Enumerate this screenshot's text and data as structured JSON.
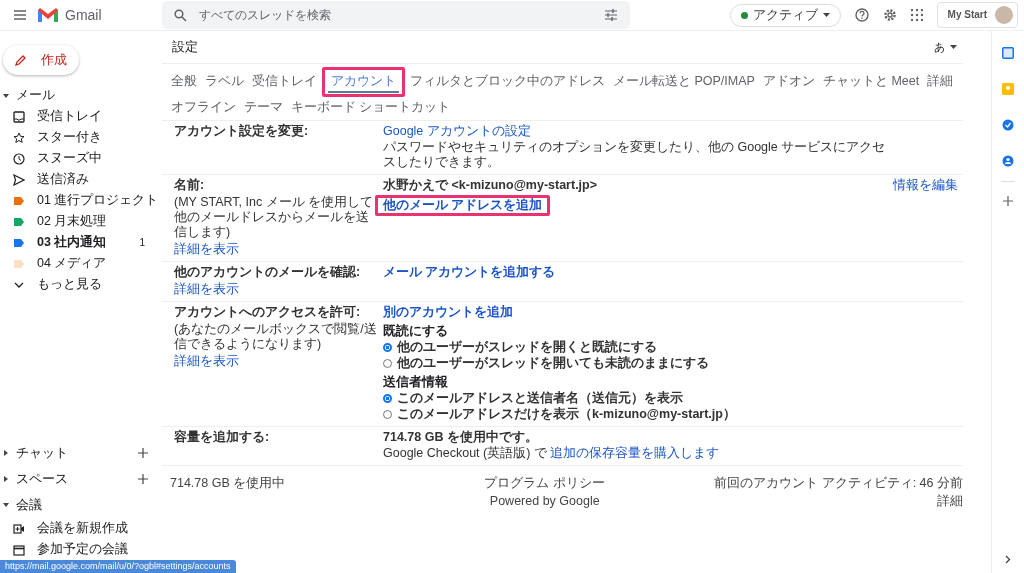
{
  "topbar": {
    "app_name": "Gmail",
    "search_placeholder": "すべてのスレッドを検索",
    "status": {
      "label": "アクティブ",
      "color": "#1e8e3e"
    },
    "org": "My Start"
  },
  "compose": "作成",
  "mail_section": {
    "label": "メール",
    "expanded": true
  },
  "sidebar_items": [
    {
      "label": "受信トレイ",
      "kind": "system",
      "unread": false
    },
    {
      "label": "スター付き",
      "kind": "system",
      "unread": false
    },
    {
      "label": "スヌーズ中",
      "kind": "system",
      "unread": false
    },
    {
      "label": "送信済み",
      "kind": "system",
      "unread": false
    },
    {
      "label": "01 進行プロジェクト",
      "kind": "label",
      "color": "#e8710a",
      "unread": false
    },
    {
      "label": "02 月末処理",
      "kind": "label",
      "color": "#16a766",
      "unread": false
    },
    {
      "label": "03 社内通知",
      "kind": "label",
      "color": "#1a73e8",
      "count": "1",
      "unread": true
    },
    {
      "label": "04 メディア",
      "kind": "label",
      "color": "#fbe0c3",
      "unread": false
    },
    {
      "label": "もっと見る",
      "kind": "more",
      "unread": false
    }
  ],
  "sections": [
    {
      "label": "チャット",
      "expanded": false
    },
    {
      "label": "スペース",
      "expanded": false
    },
    {
      "label": "会議",
      "expanded": true
    }
  ],
  "meet_items": [
    {
      "label": "会議を新規作成"
    },
    {
      "label": "参加予定の会議"
    }
  ],
  "settings": {
    "title": "設定",
    "input_tool": "あ",
    "tabs": [
      {
        "label": "全般",
        "selected": false,
        "highlighted": false
      },
      {
        "label": "ラベル",
        "selected": false,
        "highlighted": false
      },
      {
        "label": "受信トレイ",
        "selected": false,
        "highlighted": false
      },
      {
        "label": "アカウント",
        "selected": true,
        "highlighted": true
      },
      {
        "label": "フィルタとブロック中のアドレス",
        "selected": false,
        "highlighted": false
      },
      {
        "label": "メール転送と POP/IMAP",
        "selected": false,
        "highlighted": false
      },
      {
        "label": "アドオン",
        "selected": false,
        "highlighted": false
      },
      {
        "label": "チャットと Meet",
        "selected": false,
        "highlighted": false
      },
      {
        "label": "詳細",
        "selected": false,
        "highlighted": false
      },
      {
        "label": "オフライン",
        "selected": false,
        "highlighted": false
      },
      {
        "label": "テーマ",
        "selected": false,
        "highlighted": false
      },
      {
        "label": "キーボード ショートカット",
        "selected": false,
        "highlighted": false
      }
    ],
    "rows": [
      {
        "label": "アカウント設定を変更:",
        "content": [
          {
            "kind": "link",
            "text": "Google アカウントの設定",
            "bold": false,
            "highlighted": false
          },
          {
            "kind": "text",
            "text": "パスワードやセキュリティのオプションを変更したり、他の Google サービスにアクセスしたりできます。",
            "bold": false
          }
        ]
      },
      {
        "label": "名前:",
        "description": "(MY START, Inc メール を使用して他のメールドレスからメールを送信します)",
        "details_link": "詳細を表示",
        "edit_link": "情報を編集",
        "content": [
          {
            "kind": "text",
            "text": "水野かえで <k-mizuno@my-start.jp>",
            "bold": true
          },
          {
            "kind": "link",
            "text": "他のメール アドレスを追加",
            "bold": true,
            "highlighted": true
          }
        ]
      },
      {
        "label": "他のアカウントのメールを確認:",
        "details_link": "詳細を表示",
        "content": [
          {
            "kind": "link",
            "text": "メール アカウントを追加する",
            "bold": true,
            "highlighted": false
          }
        ]
      },
      {
        "label": "アカウントへのアクセスを許可:",
        "description": "(あなたのメールボックスで閲覧/送信できるようになります)",
        "details_link": "詳細を表示",
        "content": [
          {
            "kind": "link",
            "text": "別のアカウントを追加",
            "bold": true,
            "highlighted": false
          },
          {
            "kind": "radios",
            "title": "既読にする",
            "options": [
              {
                "label": "他のユーザーがスレッドを開くと既読にする",
                "selected": true
              },
              {
                "label": "他のユーザーがスレッドを開いても未読のままにする",
                "selected": false
              }
            ]
          },
          {
            "kind": "radios",
            "title": "送信者情報",
            "options": [
              {
                "label": "このメールアドレスと送信者名（送信元）を表示",
                "selected": true
              },
              {
                "label": "このメールアドレスだけを表示（k-mizuno@my-start.jp）",
                "selected": false
              }
            ]
          }
        ]
      },
      {
        "label": "容量を追加する:",
        "content": [
          {
            "kind": "text",
            "text": "714.78 GB を使用中です。",
            "bold": true
          },
          {
            "kind": "mixed",
            "text": "Google Checkout (英語版) で",
            "link": "追加の保存容量を購入します"
          }
        ]
      }
    ]
  },
  "footer": {
    "usage": "714.78 GB を使用中",
    "policy": "プログラム ポリシー",
    "powered": "Powered by Google",
    "activity": "前回のアカウント アクティビティ: 46 分前",
    "details": "詳細"
  },
  "status_url": "https://mail.google.com/mail/u/0/?ogbl#settings/accounts"
}
